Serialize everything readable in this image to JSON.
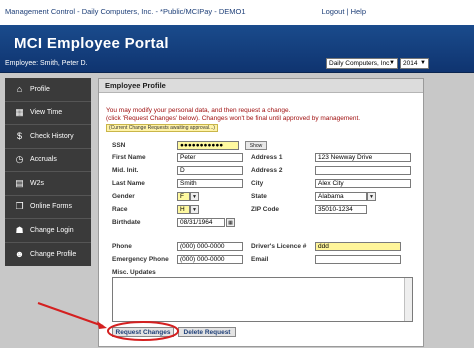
{
  "window": {
    "title": "Management Control - Daily Computers, Inc. - *Public/MCIPay - DEMO1",
    "logout": "Logout",
    "sep": "|",
    "help": "Help"
  },
  "header": {
    "portal_title": "MCI Employee Portal",
    "employee": "Employee: Smith, Peter D.",
    "company_select": "Daily Computers, Inc.",
    "year_select": "2014"
  },
  "sidebar": {
    "items": [
      {
        "label": "Profile",
        "icon": "home-icon"
      },
      {
        "label": "View Time",
        "icon": "calendar-icon"
      },
      {
        "label": "Check History",
        "icon": "money-bag-icon"
      },
      {
        "label": "Accruals",
        "icon": "clock-icon"
      },
      {
        "label": "W2s",
        "icon": "document-icon"
      },
      {
        "label": "Online Forms",
        "icon": "forms-icon"
      },
      {
        "label": "Change Login",
        "icon": "login-icon"
      },
      {
        "label": "Change Profile",
        "icon": "person-icon"
      }
    ]
  },
  "profile": {
    "heading": "Employee Profile",
    "msg1": "You may modify your personal data, and then request a change.",
    "msg2": "(click 'Request Changes' below). Changes won't be final until approved by management.",
    "pending": "(Current Change Requests awaiting approval...)",
    "labels": {
      "ssn": "SSN",
      "first_name": "First Name",
      "mid_init": "Mid. Init.",
      "last_name": "Last Name",
      "gender": "Gender",
      "race": "Race",
      "birthdate": "Birthdate",
      "address1": "Address 1",
      "address2": "Address 2",
      "city": "City",
      "state": "State",
      "zip": "ZIP Code",
      "phone": "Phone",
      "emergency_phone": "Emergency Phone",
      "drivers_license": "Driver's Licence #",
      "email": "Email",
      "misc_updates": "Misc. Updates"
    },
    "values": {
      "ssn": "●●●●●●●●●●●",
      "first_name": "Peter",
      "mid_init": "D",
      "last_name": "Smith",
      "gender": "F",
      "race": "H",
      "birthdate": "08/31/1964",
      "address1": "123 Newway Drive",
      "address2": "",
      "city": "Alex City",
      "state": "Alabama",
      "zip": "35010-1234",
      "phone": "(000) 000-0000",
      "emergency_phone": "(000) 000-0000",
      "drivers_license": "ddd",
      "email": ""
    },
    "show_button": "Show",
    "request_changes": "Request Changes",
    "delete_request": "Delete Request"
  },
  "colors": {
    "header_bg": "#1a4b8c",
    "sidebar_bg": "#3a3a3a",
    "annotation": "#d42020",
    "message_red": "#a01010"
  }
}
